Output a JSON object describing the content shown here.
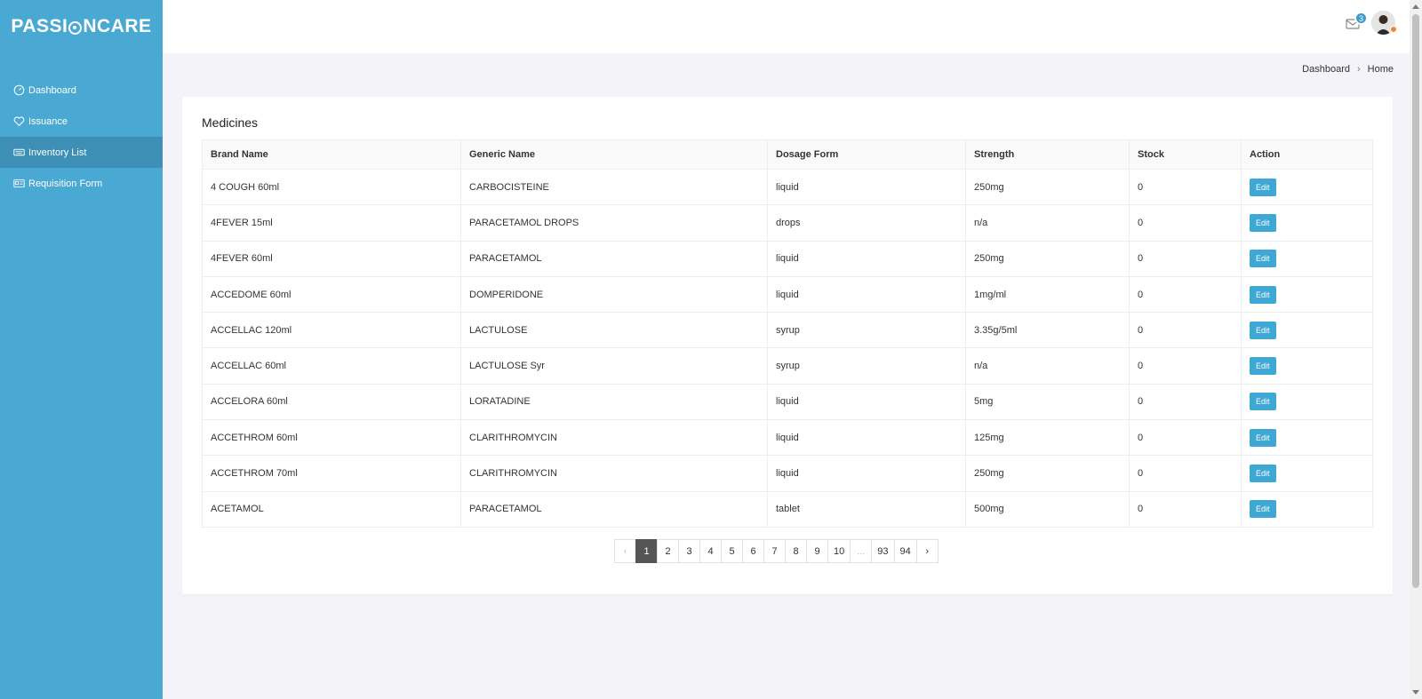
{
  "app": {
    "brand_left": "PASSI",
    "brand_right": "NCARE"
  },
  "sidebar": {
    "items": [
      {
        "label": "Dashboard",
        "icon": "speedometer-icon"
      },
      {
        "label": "Issuance",
        "icon": "heart-icon"
      },
      {
        "label": "Inventory List",
        "icon": "keyboard-icon",
        "active": true
      },
      {
        "label": "Requisition Form",
        "icon": "form-icon"
      }
    ]
  },
  "topbar": {
    "mail_count": "3"
  },
  "breadcrumb": {
    "parent": "Dashboard",
    "current": "Home"
  },
  "main": {
    "title": "Medicines",
    "columns": [
      "Brand Name",
      "Generic Name",
      "Dosage Form",
      "Strength",
      "Stock",
      "Action"
    ],
    "rows": [
      [
        "4 COUGH 60ml",
        "CARBOCISTEINE",
        "liquid",
        "250mg",
        "0"
      ],
      [
        "4FEVER 15ml",
        "PARACETAMOL DROPS",
        "drops",
        "n/a",
        "0"
      ],
      [
        "4FEVER 60ml",
        "PARACETAMOL",
        "liquid",
        "250mg",
        "0"
      ],
      [
        "ACCEDOME 60ml",
        "DOMPERIDONE",
        "liquid",
        "1mg/ml",
        "0"
      ],
      [
        "ACCELLAC 120ml",
        "LACTULOSE",
        "syrup",
        "3.35g/5ml",
        "0"
      ],
      [
        "ACCELLAC 60ml",
        "LACTULOSE Syr",
        "syrup",
        "n/a",
        "0"
      ],
      [
        "ACCELORA 60ml",
        "LORATADINE",
        "liquid",
        "5mg",
        "0"
      ],
      [
        "ACCETHROM 60ml",
        "CLARITHROMYCIN",
        "liquid",
        "125mg",
        "0"
      ],
      [
        "ACCETHROM 70ml",
        "CLARITHROMYCIN",
        "liquid",
        "250mg",
        "0"
      ],
      [
        "ACETAMOL",
        "PARACETAMOL",
        "tablet",
        "500mg",
        "0"
      ]
    ],
    "action_label": "Edit"
  },
  "pagination": {
    "prev": "‹",
    "pages": [
      "1",
      "2",
      "3",
      "4",
      "5",
      "6",
      "7",
      "8",
      "9",
      "10",
      "...",
      "93",
      "94"
    ],
    "next": "›",
    "active": "1"
  },
  "colors": {
    "sidebar": "#4aa9d3",
    "sidebar_active": "#3d8fb5",
    "accent": "#3ea7d4"
  }
}
